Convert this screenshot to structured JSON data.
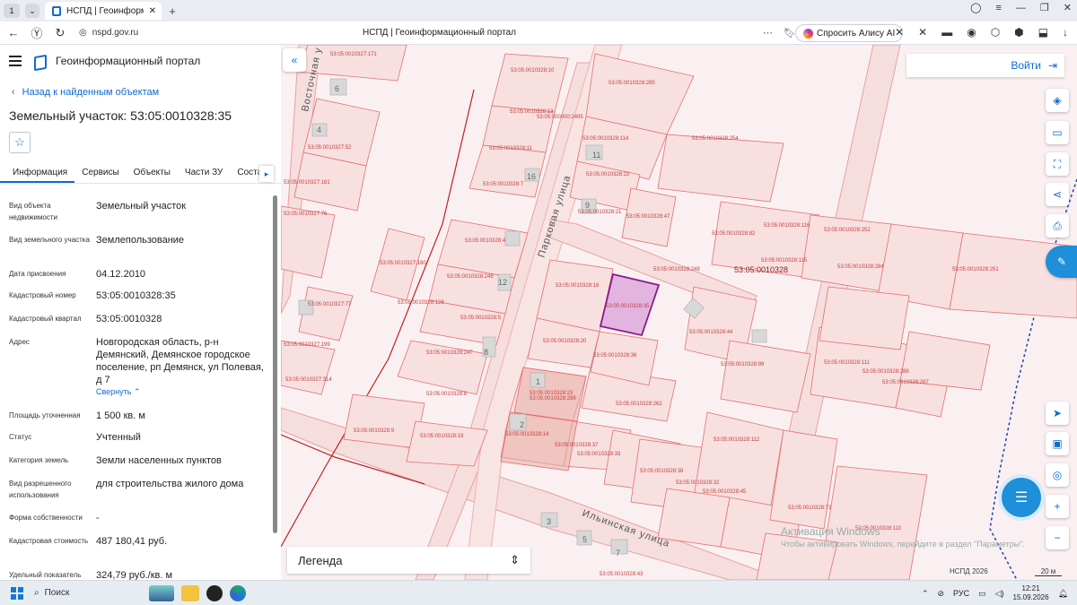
{
  "browser": {
    "tab_count": "1",
    "tab_title": "НСПД | Геоинформационный портал",
    "url": "nspd.gov.ru",
    "page_title": "НСПД | Геоинформационный портал",
    "alisa_label": "Спросить Алису AI"
  },
  "app": {
    "title": "Геоинформационный портал",
    "back_link": "Назад к найденным объектам",
    "object_title": "Земельный участок: 53:05:0010328:35",
    "tabs": [
      "Информация",
      "Сервисы",
      "Объекты",
      "Части ЗУ",
      "Состав"
    ],
    "collapse_link": "Свернуть",
    "fields": [
      {
        "label": "Вид объекта недвижимости",
        "value": "Земельный участок"
      },
      {
        "label": "Вид земельного участка",
        "value": "Землепользование"
      },
      {
        "label": "Дата присвоения",
        "value": "04.12.2010"
      },
      {
        "label": "Кадастровый номер",
        "value": "53:05:0010328:35"
      },
      {
        "label": "Кадастровый квартал",
        "value": "53:05:0010328"
      },
      {
        "label": "Адрес",
        "value": "Новгородская область, р-н Демянский, Демянское городское поселение, рп Демянск, ул Полевая, д 7"
      },
      {
        "label": "Площадь уточненная",
        "value": "1 500 кв. м"
      },
      {
        "label": "Статус",
        "value": "Учтенный"
      },
      {
        "label": "Категория земель",
        "value": "Земли населенных пунктов"
      },
      {
        "label": "Вид разрешенного использования",
        "value": "для строительства жилого дома"
      },
      {
        "label": "Форма собственности",
        "value": "-"
      },
      {
        "label": "Кадастровая стоимость",
        "value": "487 180,41 руб."
      },
      {
        "label": "Удельный показатель",
        "value": "324,79 руб./кв. м"
      }
    ]
  },
  "map": {
    "login_label": "Войти",
    "legend_label": "Легенда",
    "attribution": "НСПД 2026",
    "scale": "20 м",
    "activation_title": "Активация Windows",
    "activation_text": "Чтобы активировать Windows, перейдите в раздел \"Параметры\".",
    "streets": [
      "Парковая улица",
      "Ильинская улица",
      "Восточная у"
    ],
    "quarter_label": "53:05:0010328",
    "parcel_labels": [
      "53:05:0010328:10",
      "53:05:0010328:285",
      "53:05:0010328:13",
      "53:05:000000:2495",
      "53:05:0010328:114",
      "53:05:0010328:254",
      "53:05:0010328:11",
      "53:05:0010328:22",
      "53:05:0010328:7",
      "53:05:0010328:21",
      "53:05:0010328:47",
      "53:05:0010328:4",
      "53:05:0010328:82",
      "53:05:0010328:116",
      "53:05:0010328:252",
      "53:05:0010328:248",
      "53:05:0010328:249",
      "53:05:0010328:115",
      "53:05:0010328:284",
      "53:05:0010328:251",
      "53:05:0010327:180",
      "53:05:0010328:126",
      "53:05:0010328:18",
      "53:05:0010328:35",
      "53:05:0010328:5",
      "53:05:0010328:20",
      "53:05:0010328:44",
      "53:05:0010328:247",
      "53:05:0010328:36",
      "53:05:0010328:99",
      "53:05:0010328:111",
      "53:05:0010328:288",
      "53:05:0010328:287",
      "53:05:0010328:8",
      "53:05:0010328:23",
      "53:05:0010328:289",
      "53:05:0010328:262",
      "53:05:0010328:9",
      "53:05:0010328:19",
      "53:05:0010328:14",
      "53:05:0010328:37",
      "53:05:0010328:112",
      "53:05:0010328:33",
      "53:05:0010328:38",
      "53:05:0010328:32",
      "53:05:0010328:45",
      "53:05:0010328:73",
      "53:05:0010328:110",
      "53:05:0010328:43",
      "53:05:0010327:171",
      "53:05:0010327:181",
      "53:05:0010327:52",
      "53:05:0010327:76",
      "53:05:0010327:77",
      "53:05:0010327:199",
      "53:05:0010327:314"
    ],
    "house_numbers": [
      "6",
      "4",
      "11",
      "16",
      "9",
      "12",
      "8",
      "1",
      "2",
      "3",
      "5",
      "7"
    ]
  },
  "taskbar": {
    "search_label": "Поиск",
    "lang": "РУС",
    "time": "12:21",
    "date": "15.09.2026"
  },
  "colors": {
    "accent": "#0c6bd2",
    "selected_parcel": "#d9a0d8",
    "parcel_line": "#e07070"
  }
}
